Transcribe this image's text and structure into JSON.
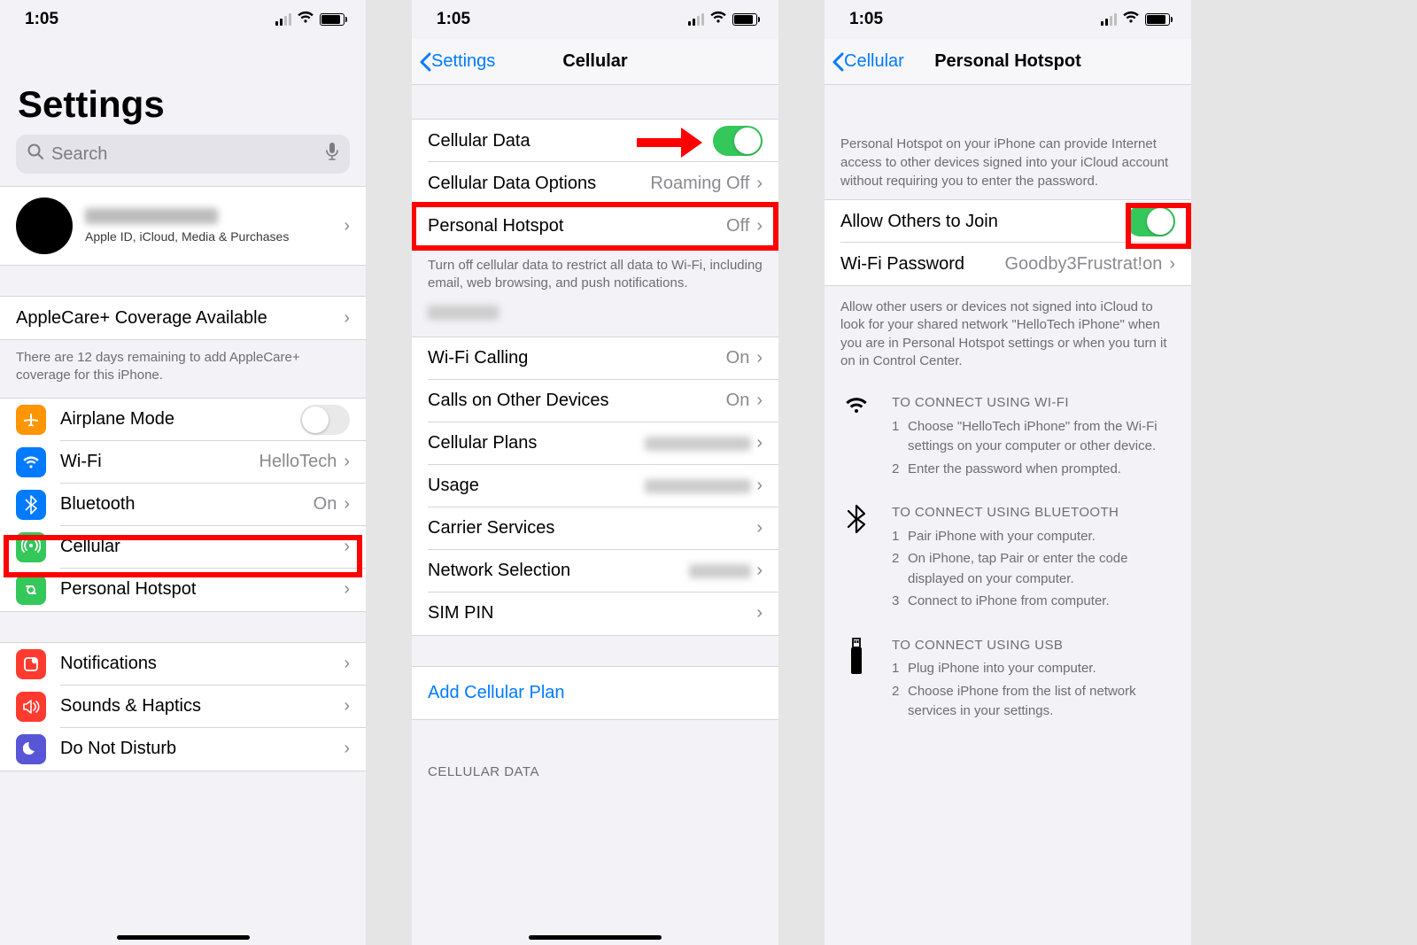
{
  "status": {
    "time": "1:05"
  },
  "screen1": {
    "title": "Settings",
    "search_placeholder": "Search",
    "profile_sub": "Apple ID, iCloud, Media & Purchases",
    "applecare": "AppleCare+ Coverage Available",
    "applecare_footer": "There are 12 days remaining to add AppleCare+ coverage for this iPhone.",
    "rows": {
      "airplane": "Airplane Mode",
      "wifi": "Wi-Fi",
      "wifi_val": "HelloTech",
      "bluetooth": "Bluetooth",
      "bluetooth_val": "On",
      "cellular": "Cellular",
      "hotspot": "Personal Hotspot",
      "notifications": "Notifications",
      "sounds": "Sounds & Haptics",
      "dnd": "Do Not Disturb"
    }
  },
  "screen2": {
    "back": "Settings",
    "title": "Cellular",
    "rows": {
      "data": "Cellular Data",
      "options": "Cellular Data Options",
      "options_val": "Roaming Off",
      "hotspot": "Personal Hotspot",
      "hotspot_val": "Off",
      "wifi_calling": "Wi-Fi Calling",
      "wifi_calling_val": "On",
      "calls_other": "Calls on Other Devices",
      "calls_other_val": "On",
      "plans": "Cellular Plans",
      "usage": "Usage",
      "carrier": "Carrier Services",
      "network": "Network Selection",
      "sim": "SIM PIN"
    },
    "footer1": "Turn off cellular data to restrict all data to Wi-Fi, including email, web browsing, and push notifications.",
    "add_plan": "Add Cellular Plan",
    "section_head": "CELLULAR DATA"
  },
  "screen3": {
    "back": "Cellular",
    "title": "Personal Hotspot",
    "intro": "Personal Hotspot on your iPhone can provide Internet access to other devices signed into your iCloud account without requiring you to enter the password.",
    "allow": "Allow Others to Join",
    "wifi_password": "Wi-Fi Password",
    "wifi_password_val": "Goodby3Frustrat!on",
    "allow_footer": "Allow other users or devices not signed into iCloud to look for your shared network \"HelloTech iPhone\" when you are in Personal Hotspot settings or when you turn it on in Control Center.",
    "wifi_title": "TO CONNECT USING WI-FI",
    "wifi_steps": [
      "Choose \"HelloTech iPhone\" from the Wi-Fi settings on your computer or other device.",
      "Enter the password when prompted."
    ],
    "bt_title": "TO CONNECT USING BLUETOOTH",
    "bt_steps": [
      "Pair iPhone with your computer.",
      "On iPhone, tap Pair or enter the code displayed on your computer.",
      "Connect to iPhone from computer."
    ],
    "usb_title": "TO CONNECT USING USB",
    "usb_steps": [
      "Plug iPhone into your computer.",
      "Choose iPhone from the list of network services in your settings."
    ]
  }
}
